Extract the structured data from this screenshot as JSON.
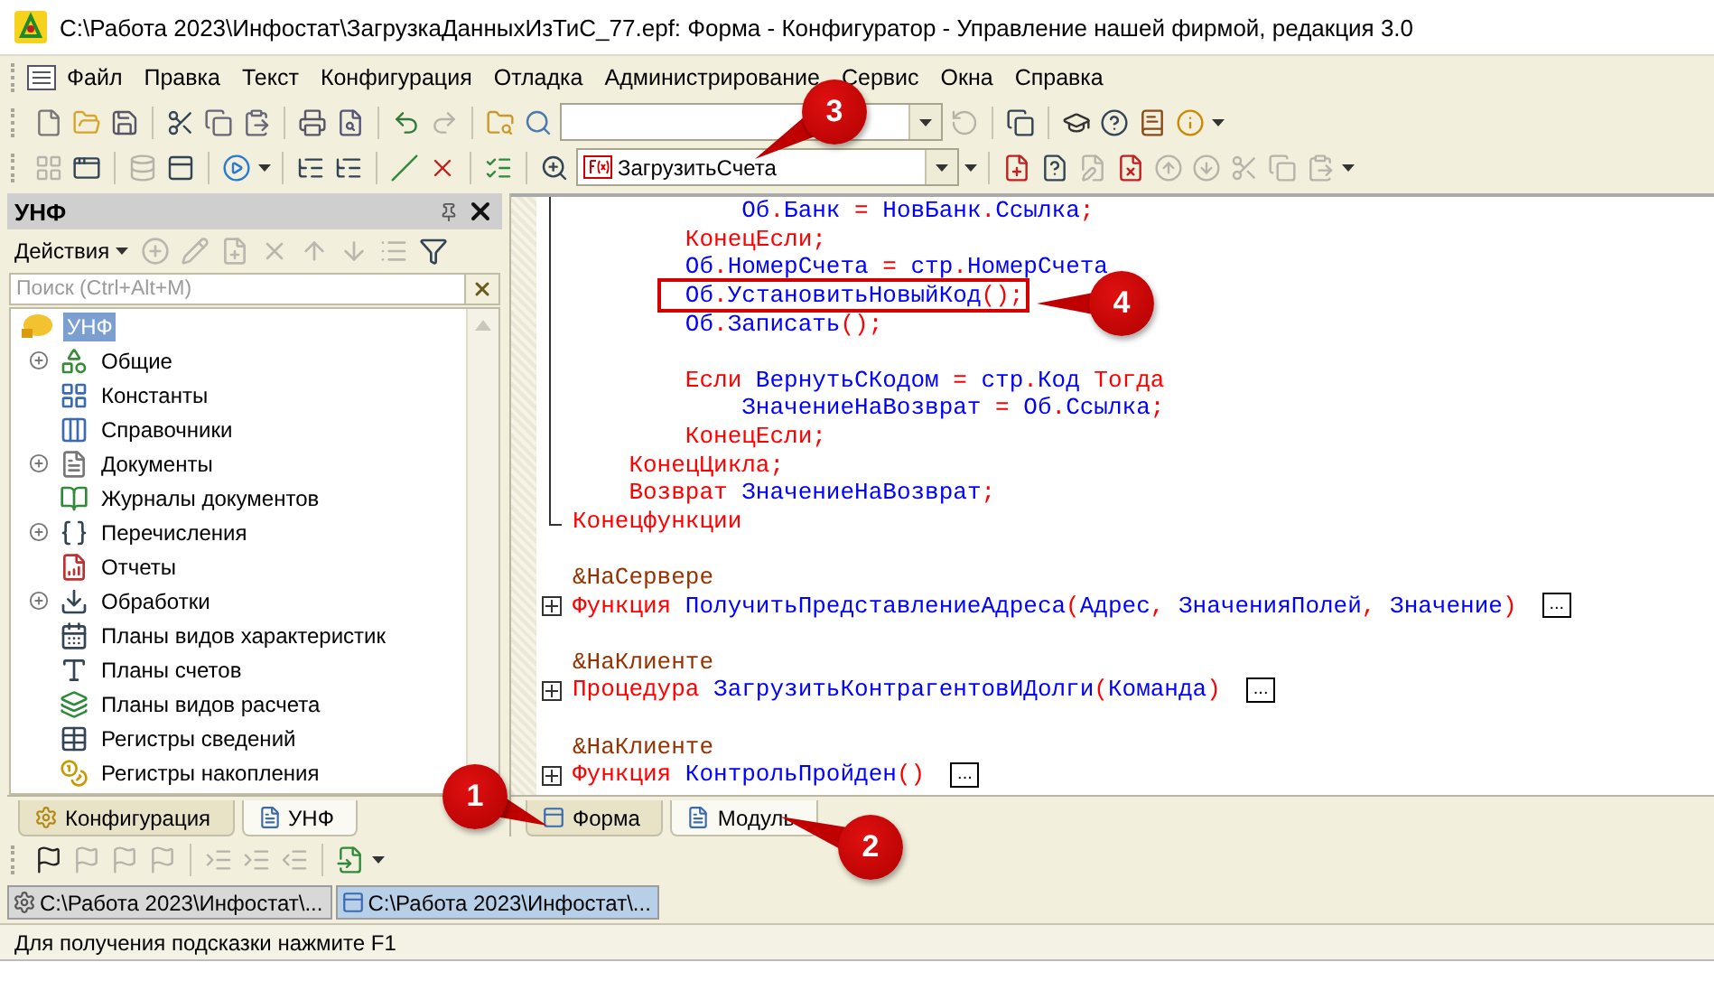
{
  "window": {
    "title": "C:\\Работа 2023\\Инфостат\\ЗагрузкаДанныхИзТиС_77.epf: Форма - Конфигуратор - Управление нашей фирмой, редакция 3.0"
  },
  "menu": [
    "Файл",
    "Правка",
    "Текст",
    "Конфигурация",
    "Отладка",
    "Администрирование",
    "Сервис",
    "Окна",
    "Справка"
  ],
  "toolbar_1": {
    "buttons": [
      {
        "disabled": false
      },
      {
        "disabled": false
      },
      {
        "disabled": false
      },
      {
        "disabled": false
      },
      {
        "disabled": false
      },
      {
        "disabled": false
      },
      {
        "disabled": false
      },
      {
        "disabled": false
      },
      {
        "disabled": false
      },
      {
        "disabled": true
      },
      {
        "disabled": false
      },
      {
        "disabled": false
      },
      {
        "disabled": true
      },
      {
        "disabled": false
      },
      {
        "disabled": false
      },
      {
        "disabled": false
      },
      {
        "disabled": false
      },
      {
        "disabled": false
      }
    ]
  },
  "toolbar_2": {
    "buttons": [
      {
        "disabled": true
      },
      {
        "disabled": false
      },
      {
        "disabled": true
      },
      {
        "disabled": false
      },
      {
        "disabled": false
      },
      {
        "disabled": false
      },
      {
        "disabled": false
      },
      {
        "disabled": false
      },
      {
        "disabled": false
      },
      {
        "disabled": false
      },
      {
        "disabled": false
      },
      {
        "disabled": false
      },
      {
        "disabled": false
      },
      {
        "disabled": true
      },
      {
        "disabled": false
      },
      {
        "disabled": true
      },
      {
        "disabled": true
      },
      {
        "disabled": true
      },
      {
        "disabled": true
      },
      {
        "disabled": true
      }
    ],
    "module_selector": {
      "value": "ЗагрузитьСчета"
    }
  },
  "left_panel": {
    "title": "УНФ",
    "actions": {
      "label": "Действия",
      "buttons": [
        {
          "disabled": true
        },
        {
          "disabled": true
        },
        {
          "disabled": true
        },
        {
          "disabled": true
        },
        {
          "disabled": true
        },
        {
          "disabled": true
        },
        {
          "disabled": true
        },
        {
          "disabled": false
        }
      ]
    },
    "search": {
      "placeholder": "Поиск (Ctrl+Alt+M)"
    },
    "tree": [
      {
        "label": "УНФ",
        "selected": true,
        "children": [
          {
            "label": "Общие",
            "expandable": true
          },
          {
            "label": "Константы",
            "expandable": false
          },
          {
            "label": "Справочники",
            "expandable": false
          },
          {
            "label": "Документы",
            "expandable": true
          },
          {
            "label": "Журналы документов",
            "expandable": false
          },
          {
            "label": "Перечисления",
            "expandable": true
          },
          {
            "label": "Отчеты",
            "expandable": false
          },
          {
            "label": "Обработки",
            "expandable": true
          },
          {
            "label": "Планы видов характеристик",
            "expandable": false
          },
          {
            "label": "Планы счетов",
            "expandable": false
          },
          {
            "label": "Планы видов расчета",
            "expandable": false
          },
          {
            "label": "Регистры сведений",
            "expandable": false
          },
          {
            "label": "Регистры накопления",
            "expandable": false
          }
        ]
      }
    ],
    "tabs": [
      {
        "label": "Конфигурация",
        "selected": false
      },
      {
        "label": "УНФ",
        "selected": true
      }
    ]
  },
  "editor": {
    "lines": [
      {
        "kind": "block",
        "tokens": [
          {
            "kind": "identifier",
            "text": "            Об"
          },
          {
            "kind": "operator",
            "text": "."
          },
          {
            "kind": "identifier",
            "text": "Банк"
          },
          {
            "kind": "operator",
            "text": " = "
          },
          {
            "kind": "identifier",
            "text": "НовБанк"
          },
          {
            "kind": "operator",
            "text": "."
          },
          {
            "kind": "identifier",
            "text": "Ссылка"
          },
          {
            "kind": "operator",
            "text": ";"
          }
        ]
      },
      {
        "kind": "block",
        "tokens": [
          {
            "kind": "keyword",
            "text": "        КонецЕсли"
          },
          {
            "kind": "operator",
            "text": ";"
          }
        ]
      },
      {
        "kind": "block",
        "tokens": [
          {
            "kind": "identifier",
            "text": "        Об"
          },
          {
            "kind": "operator",
            "text": "."
          },
          {
            "kind": "identifier",
            "text": "НомерСчета"
          },
          {
            "kind": "operator",
            "text": " = "
          },
          {
            "kind": "identifier",
            "text": "стр"
          },
          {
            "kind": "operator",
            "text": "."
          },
          {
            "kind": "identifier",
            "text": "НомерСчета"
          }
        ]
      },
      {
        "kind": "block",
        "highlighted": true,
        "tokens": [
          {
            "kind": "identifier",
            "text": "        Об"
          },
          {
            "kind": "operator",
            "text": "."
          },
          {
            "kind": "identifier",
            "text": "УстановитьНовыйКод"
          },
          {
            "kind": "operator",
            "text": "();"
          }
        ]
      },
      {
        "kind": "block",
        "tokens": [
          {
            "kind": "identifier",
            "text": "        Об"
          },
          {
            "kind": "operator",
            "text": "."
          },
          {
            "kind": "identifier",
            "text": "Записать"
          },
          {
            "kind": "operator",
            "text": "();"
          }
        ]
      },
      {
        "kind": "block"
      },
      {
        "kind": "block",
        "tokens": [
          {
            "kind": "keyword",
            "text": "        Если"
          },
          {
            "kind": "identifier",
            "text": " ВернутьСКодом"
          },
          {
            "kind": "operator",
            "text": " = "
          },
          {
            "kind": "identifier",
            "text": "стр"
          },
          {
            "kind": "operator",
            "text": "."
          },
          {
            "kind": "identifier",
            "text": "Код"
          },
          {
            "kind": "keyword",
            "text": " Тогда"
          }
        ]
      },
      {
        "kind": "block",
        "tokens": [
          {
            "kind": "identifier",
            "text": "            ЗначениеНаВозврат"
          },
          {
            "kind": "operator",
            "text": " = "
          },
          {
            "kind": "identifier",
            "text": "Об"
          },
          {
            "kind": "operator",
            "text": "."
          },
          {
            "kind": "identifier",
            "text": "Ссылка"
          },
          {
            "kind": "operator",
            "text": ";"
          }
        ]
      },
      {
        "kind": "block",
        "tokens": [
          {
            "kind": "keyword",
            "text": "        КонецЕсли"
          },
          {
            "kind": "operator",
            "text": ";"
          }
        ]
      },
      {
        "kind": "block",
        "tokens": [
          {
            "kind": "keyword",
            "text": "    КонецЦикла"
          },
          {
            "kind": "operator",
            "text": ";"
          }
        ]
      },
      {
        "kind": "block",
        "tokens": [
          {
            "kind": "keyword",
            "text": "    Возврат"
          },
          {
            "kind": "identifier",
            "text": " ЗначениеНаВозврат"
          },
          {
            "kind": "operator",
            "text": ";"
          }
        ]
      },
      {
        "kind": "block_end",
        "tokens": [
          {
            "kind": "keyword",
            "text": "Конецфункции"
          }
        ]
      },
      {
        "kind": "plain"
      },
      {
        "kind": "plain",
        "tokens": [
          {
            "kind": "directive",
            "text": "&НаСервере"
          }
        ]
      },
      {
        "kind": "collapsed",
        "fold_label": "...",
        "tokens": [
          {
            "kind": "keyword",
            "text": "Функция"
          },
          {
            "kind": "identifier",
            "text": " ПолучитьПредставлениеАдреса"
          },
          {
            "kind": "operator",
            "text": "("
          },
          {
            "kind": "identifier",
            "text": "Адрес"
          },
          {
            "kind": "operator",
            "text": ", "
          },
          {
            "kind": "identifier",
            "text": "ЗначенияПолей"
          },
          {
            "kind": "operator",
            "text": ", "
          },
          {
            "kind": "identifier",
            "text": "Значение"
          },
          {
            "kind": "operator",
            "text": ")"
          }
        ]
      },
      {
        "kind": "plain"
      },
      {
        "kind": "plain",
        "tokens": [
          {
            "kind": "directive",
            "text": "&НаКлиенте"
          }
        ]
      },
      {
        "kind": "collapsed",
        "fold_label": "...",
        "tokens": [
          {
            "kind": "keyword",
            "text": "Процедура"
          },
          {
            "kind": "identifier",
            "text": " ЗагрузитьКонтрагентовИДолги"
          },
          {
            "kind": "operator",
            "text": "("
          },
          {
            "kind": "identifier",
            "text": "Команда"
          },
          {
            "kind": "operator",
            "text": ")"
          }
        ]
      },
      {
        "kind": "plain"
      },
      {
        "kind": "plain",
        "tokens": [
          {
            "kind": "directive",
            "text": "&НаКлиенте"
          }
        ]
      },
      {
        "kind": "collapsed",
        "fold_label": "...",
        "tokens": [
          {
            "kind": "keyword",
            "text": "Функция"
          },
          {
            "kind": "identifier",
            "text": " КонтрольПройден"
          },
          {
            "kind": "operator",
            "text": "()"
          }
        ]
      }
    ],
    "tabs": [
      {
        "label": "Форма",
        "selected": false
      },
      {
        "label": "Модуль",
        "selected": true
      }
    ]
  },
  "toolbar_3": {
    "buttons": [
      {
        "disabled": false
      },
      {
        "disabled": true
      },
      {
        "disabled": true
      },
      {
        "disabled": true
      },
      {
        "disabled": true
      },
      {
        "disabled": true
      },
      {
        "disabled": true
      },
      {
        "disabled": false
      }
    ]
  },
  "windows": [
    {
      "title": "C:\\Работа 2023\\Инфостат\\...",
      "selected": false
    },
    {
      "title": "C:\\Работа 2023\\Инфостат\\...",
      "selected": true
    }
  ],
  "status_bar": "Для получения подсказки нажмите F1",
  "annotations": [
    {
      "label": "1"
    },
    {
      "label": "2"
    },
    {
      "label": "3"
    },
    {
      "label": "4"
    }
  ]
}
